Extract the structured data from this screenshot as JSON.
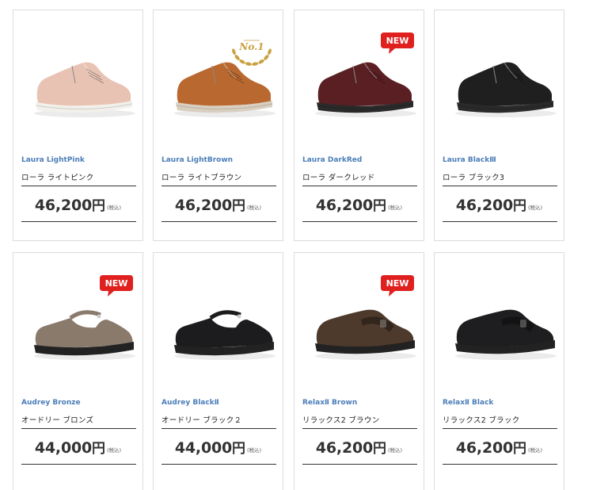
{
  "products": [
    {
      "en": "Laura LightPink",
      "jp": "ローラ ライトピンク",
      "price": "46,200",
      "yen": "円",
      "tax": "(税込)",
      "badge": "",
      "color": "#e8c3b4",
      "sole": "#f2f0ea",
      "style": "sneaker"
    },
    {
      "en": "Laura LightBrown",
      "jp": "ローラ ライトブラウン",
      "price": "46,200",
      "yen": "円",
      "tax": "(税込)",
      "badge": "no1",
      "badge_text": "No.1",
      "color": "#b9692f",
      "sole": "#d9cfc0",
      "style": "sneaker"
    },
    {
      "en": "Laura DarkRed",
      "jp": "ローラ ダークレッド",
      "price": "46,200",
      "yen": "円",
      "tax": "(税込)",
      "badge": "new",
      "badge_text": "NEW",
      "color": "#5a1f22",
      "sole": "#2a2a2a",
      "style": "sneaker"
    },
    {
      "en": "Laura BlackⅢ",
      "jp": "ローラ ブラック3",
      "price": "46,200",
      "yen": "円",
      "tax": "(税込)",
      "badge": "",
      "color": "#1f1f1f",
      "sole": "#2a2a2a",
      "style": "sneaker"
    },
    {
      "en": "Audrey Bronze",
      "jp": "オードリー ブロンズ",
      "price": "44,000",
      "yen": "円",
      "tax": "(税込)",
      "badge": "new",
      "badge_text": "NEW",
      "color": "#8a7a6c",
      "sole": "#222",
      "style": "mary"
    },
    {
      "en": "Audrey BlackⅡ",
      "jp": "オードリー ブラック２",
      "price": "44,000",
      "yen": "円",
      "tax": "(税込)",
      "badge": "",
      "color": "#1c1c1e",
      "sole": "#222",
      "style": "mary"
    },
    {
      "en": "RelaxⅡ Brown",
      "jp": "リラックス2 ブラウン",
      "price": "46,200",
      "yen": "円",
      "tax": "(税込)",
      "badge": "new",
      "badge_text": "NEW",
      "color": "#4e3a2c",
      "sole": "#222",
      "style": "velcro"
    },
    {
      "en": "RelaxⅡ Black",
      "jp": "リラックス2 ブラック",
      "price": "46,200",
      "yen": "円",
      "tax": "(税込)",
      "badge": "",
      "color": "#1e1e20",
      "sole": "#222",
      "style": "velcro"
    }
  ]
}
